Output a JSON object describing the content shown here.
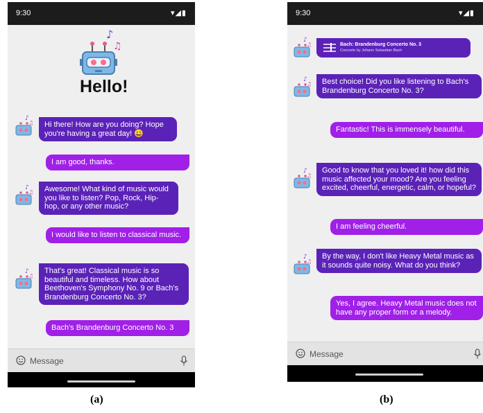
{
  "status": {
    "time": "9:30"
  },
  "icons": {
    "robot": "robot-icon",
    "music_notes": "music-notes-icon",
    "smile": "smile-icon",
    "mic": "mic-icon",
    "sheet_music": "sheet-music-icon",
    "signal_battery": "signal-battery-icon"
  },
  "colors": {
    "bot_bubble": "#5b22b8",
    "user_bubble": "#a020e8",
    "status_bar": "#1c1c1c",
    "background": "#efefef"
  },
  "panel_a": {
    "caption": "(a)",
    "greeting": "Hello!",
    "messages": [
      {
        "from": "bot",
        "text": "Hi there! How are you doing? Hope you're having a great day! 😀"
      },
      {
        "from": "user",
        "text": "I am good, thanks."
      },
      {
        "from": "bot",
        "text": "Awesome! What kind of music would you like to listen? Pop, Rock, Hip-hop, or any other music?"
      },
      {
        "from": "user",
        "text": "I would like to listen to classical music."
      },
      {
        "from": "bot",
        "text": "That's great! Classical music is so beautiful and timeless. How about Beethoven's Symphony No. 9 or Bach's Brandenburg Concerto No. 3?"
      },
      {
        "from": "user",
        "text": "Bach's Brandenburg Concerto No. 3"
      }
    ],
    "input_placeholder": "Message"
  },
  "panel_b": {
    "caption": "(b)",
    "music_card": {
      "title": "Bach: Brandenburg Concerto No. 3",
      "subtitle": "Concerto by Johann Sebastian Bach"
    },
    "messages": [
      {
        "from": "bot",
        "text": "Best choice! Did you like listening to Bach's Brandenburg Concerto No. 3?"
      },
      {
        "from": "user",
        "text": "Fantastic! This is immensely beautiful."
      },
      {
        "from": "bot",
        "text": "Good to know that you loved it! how did this music affected your mood? Are you feeling excited, cheerful, energetic, calm, or hopeful?"
      },
      {
        "from": "user",
        "text": "I am feeling cheerful."
      },
      {
        "from": "bot",
        "text": "By the way, I don't like Heavy Metal music as it sounds quite noisy. What do you think?"
      },
      {
        "from": "user",
        "text": "Yes, I agree. Heavy Metal music does not have any proper form or a melody."
      }
    ],
    "input_placeholder": "Message"
  }
}
